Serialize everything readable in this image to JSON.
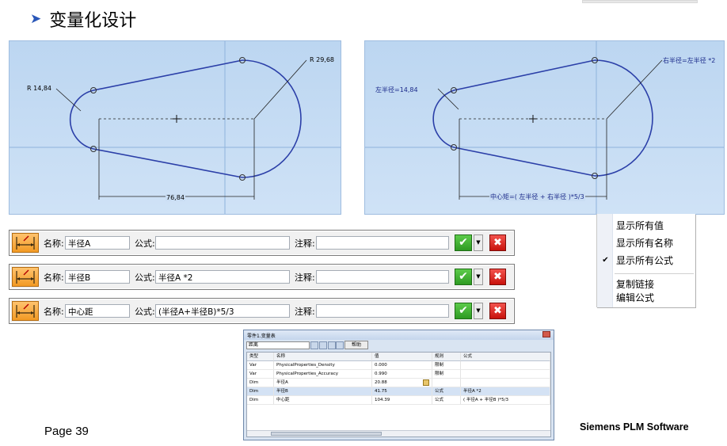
{
  "slide": {
    "title": "变量化设计",
    "page": "Page 39",
    "brand": "Siemens PLM Software"
  },
  "sketch_left": {
    "r_small": "R 14,84",
    "r_large": "R 29,68",
    "distance": "76,84"
  },
  "sketch_right": {
    "r_small": "左半径=14,84",
    "r_large": "右半径=左半径 *2",
    "distance": "中心矩=( 左半径 + 右半径 )*5/3"
  },
  "var_rows": [
    {
      "name_label": "名称:",
      "name": "半径A",
      "formula_label": "公式:",
      "formula": "",
      "note_label": "注释:",
      "note": ""
    },
    {
      "name_label": "名称:",
      "name": "半径B",
      "formula_label": "公式:",
      "formula": "半径A *2",
      "note_label": "注释:",
      "note": ""
    },
    {
      "name_label": "名称:",
      "name": "中心距",
      "formula_label": "公式:",
      "formula": "(半径A+半径B)*5/3",
      "note_label": "注释:",
      "note": ""
    }
  ],
  "icons": {
    "dimension": "dimension-variable-icon",
    "accept": "check-icon",
    "dropdown": "chevron-down-icon",
    "cancel": "close-icon"
  },
  "colors": {
    "sketch_curve": "#2b3fa8",
    "accept": "#2e9a22",
    "cancel": "#c8120c",
    "title_arrow": "#2a57b8"
  },
  "context_menu": {
    "items": [
      "显示所有值",
      "显示所有名称",
      "显示所有公式",
      "复制链接",
      "编辑公式"
    ],
    "checked": "显示所有公式"
  },
  "variable_table": {
    "title": "零件1.变量表",
    "filter": "距离",
    "help": "帮助",
    "headers": [
      "类型",
      "名称",
      "值",
      "规则",
      "公式"
    ],
    "rows": [
      [
        "Var",
        "PhysicalProperties_Density",
        "0.000",
        "限制",
        ""
      ],
      [
        "Var",
        "PhysicalProperties_Accuracy",
        "0.990",
        "限制",
        ""
      ],
      [
        "Dim",
        "半径A",
        "20.88",
        "",
        ""
      ],
      [
        "Dim",
        "半径B",
        "41.75",
        "公式",
        "半径A *2"
      ],
      [
        "Dim",
        "中心距",
        "104.39",
        "公式",
        "( 半径A + 半径B )*5/3"
      ]
    ]
  }
}
